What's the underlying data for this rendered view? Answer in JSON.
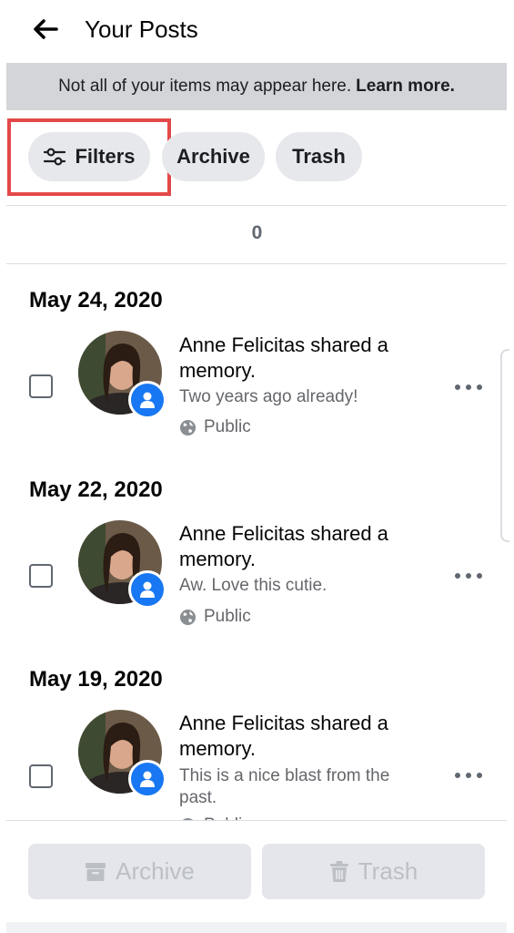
{
  "header": {
    "title": "Your Posts",
    "back_icon": "arrow-left-icon"
  },
  "notice": {
    "text": "Not all of your items may appear here.",
    "link": "Learn more."
  },
  "chips": {
    "filters": "Filters",
    "archive": "Archive",
    "trash": "Trash"
  },
  "selected_count": "0",
  "posts": [
    {
      "date": "May 24, 2020",
      "title": "Anne Felicitas shared a memory.",
      "caption": "Two years ago already!",
      "privacy": "Public"
    },
    {
      "date": "May 22, 2020",
      "title": "Anne Felicitas shared a memory.",
      "caption": "Aw. Love this cutie.",
      "privacy": "Public"
    },
    {
      "date": "May 19, 2020",
      "title": "Anne Felicitas shared a memory.",
      "caption": "This is a nice blast from the past.",
      "privacy": "Public"
    }
  ],
  "actions": {
    "archive": "Archive",
    "trash": "Trash"
  },
  "colors": {
    "accent": "#1877f2",
    "highlight": "#e4494a",
    "notice_bg": "#d3d5d8",
    "chip_bg": "#e7e8ec"
  }
}
